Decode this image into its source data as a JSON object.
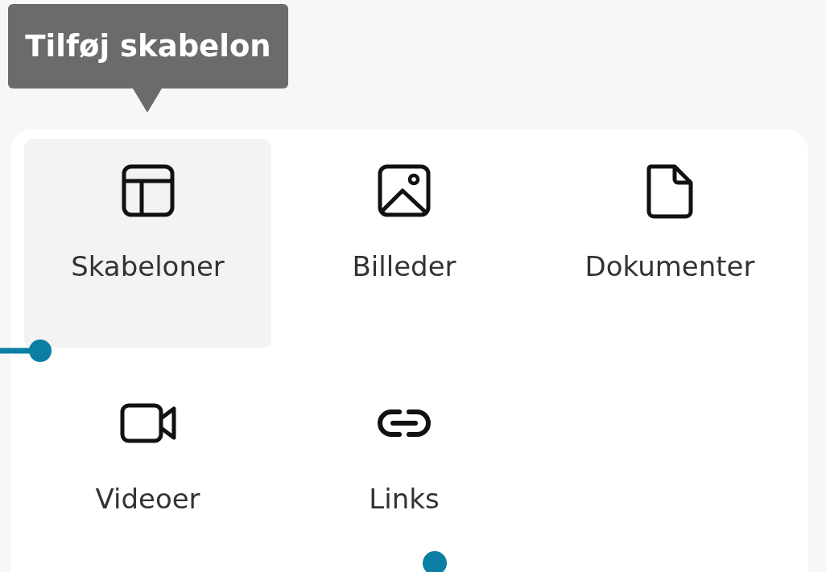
{
  "tooltip": {
    "text": "Tilføj skabelon"
  },
  "items": [
    {
      "kind": "templates",
      "label": "Skabeloner",
      "selected": true
    },
    {
      "kind": "image",
      "label": "Billeder",
      "selected": false
    },
    {
      "kind": "document",
      "label": "Dokumenter",
      "selected": false
    },
    {
      "kind": "video",
      "label": "Videoer",
      "selected": false
    },
    {
      "kind": "link",
      "label": "Links",
      "selected": false
    }
  ]
}
